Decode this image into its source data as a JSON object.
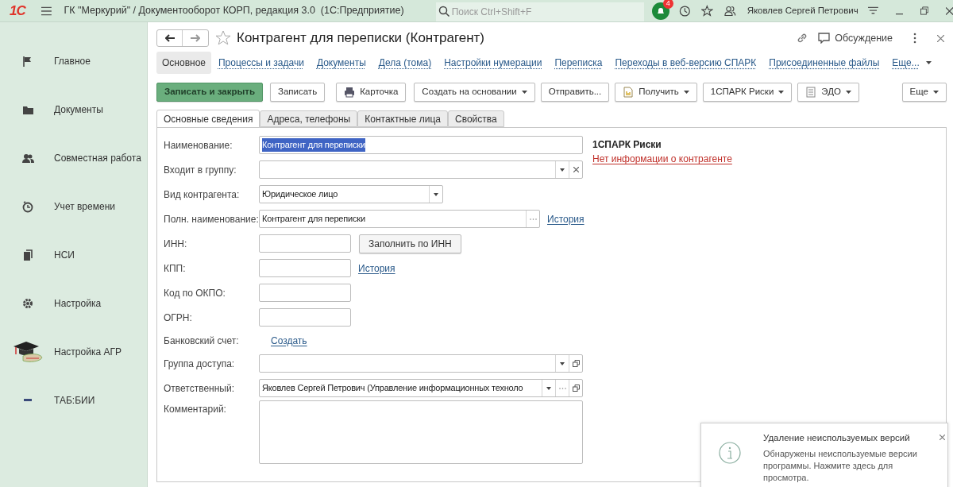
{
  "topbar": {
    "logo": "1С",
    "title": "ГК \"Меркурий\" / Документооборот КОРП, редакция 3.0  (1С:Предприятие)",
    "search": {
      "placeholder": "Поиск Ctrl+Shift+F"
    },
    "notifications_count": "4",
    "user": "Яковлев Сергей Петрович"
  },
  "sidebar": {
    "items": [
      {
        "label": "Главное"
      },
      {
        "label": "Документы"
      },
      {
        "label": "Совместная работа"
      },
      {
        "label": "Учет времени"
      },
      {
        "label": "НСИ"
      },
      {
        "label": "Настройка"
      },
      {
        "label": "Настройка АГР"
      },
      {
        "label": "ТАБ:БИИ"
      }
    ]
  },
  "form": {
    "title": "Контрагент для переписки (Контрагент)",
    "discussion": "Обсуждение",
    "sections": [
      {
        "label": "Основное",
        "selected": true
      },
      {
        "label": "Процессы и задачи",
        "selected": false
      },
      {
        "label": "Документы",
        "selected": false
      },
      {
        "label": "Дела (тома)",
        "selected": false
      },
      {
        "label": "Настройки нумерации",
        "selected": false
      },
      {
        "label": "Переписка",
        "selected": false
      },
      {
        "label": "Переходы в веб-версию СПАРК",
        "selected": false
      },
      {
        "label": "Присоединенные файлы",
        "selected": false
      },
      {
        "label": "Еще...",
        "selected": false,
        "dropdown": true
      }
    ],
    "toolbar": [
      {
        "label": "Записать и закрыть",
        "primary": true,
        "dropdown": false
      },
      {
        "label": "Записать",
        "primary": false,
        "dropdown": false
      },
      {
        "label": "Карточка",
        "primary": false,
        "dropdown": false
      },
      {
        "label": "Создать на основании",
        "primary": false,
        "dropdown": true
      },
      {
        "label": "Отправить...",
        "primary": false,
        "dropdown": false
      },
      {
        "label": "Получить",
        "primary": false,
        "dropdown": true
      },
      {
        "label": "1СПАРК Риски",
        "primary": false,
        "dropdown": true
      },
      {
        "label": "ЭДО",
        "primary": false,
        "dropdown": true
      },
      {
        "label": "Еще",
        "primary": false,
        "dropdown": true
      }
    ],
    "tabs": [
      {
        "label": "Основные сведения",
        "selected": true
      },
      {
        "label": "Адреса, телефоны",
        "selected": false
      },
      {
        "label": "Контактные лица",
        "selected": false
      },
      {
        "label": "Свойства",
        "selected": false
      }
    ],
    "fields": [
      {
        "label": "Наименование:",
        "kind": "text",
        "value": "Контрагент для переписки",
        "highlighted": true
      },
      {
        "label": "Входит в группу:",
        "kind": "select_clear"
      },
      {
        "label": "Вид контрагента:",
        "kind": "select",
        "value": "Юридическое лицо"
      },
      {
        "label": "Полн. наименование:",
        "kind": "text_more",
        "value": "Контрагент для переписки",
        "link": "История"
      },
      {
        "label": "ИНН:",
        "kind": "short",
        "button": "Заполнить по ИНН"
      },
      {
        "label": "КПП:",
        "kind": "short",
        "link": "История"
      },
      {
        "label": "Код по ОКПО:",
        "kind": "short"
      },
      {
        "label": "ОГРН:",
        "kind": "short"
      },
      {
        "label": "Банковский счет:",
        "kind": "link_only",
        "link": "Создать"
      },
      {
        "label": "Группа доступа:",
        "kind": "select_open"
      },
      {
        "label": "Ответственный:",
        "kind": "select_more_open",
        "value": "Яковлев Сергей Петрович (Управление информационных техноло"
      },
      {
        "label": "Комментарий:",
        "kind": "textarea"
      }
    ],
    "spark": {
      "title": "1СПАРК Риски",
      "link": "Нет информации о контрагенте"
    }
  },
  "notification": {
    "title": "Удаление неиспользуемых версий",
    "text": "Обнаружены неиспользуемые версии программы. Нажмите здесь для просмотра."
  }
}
